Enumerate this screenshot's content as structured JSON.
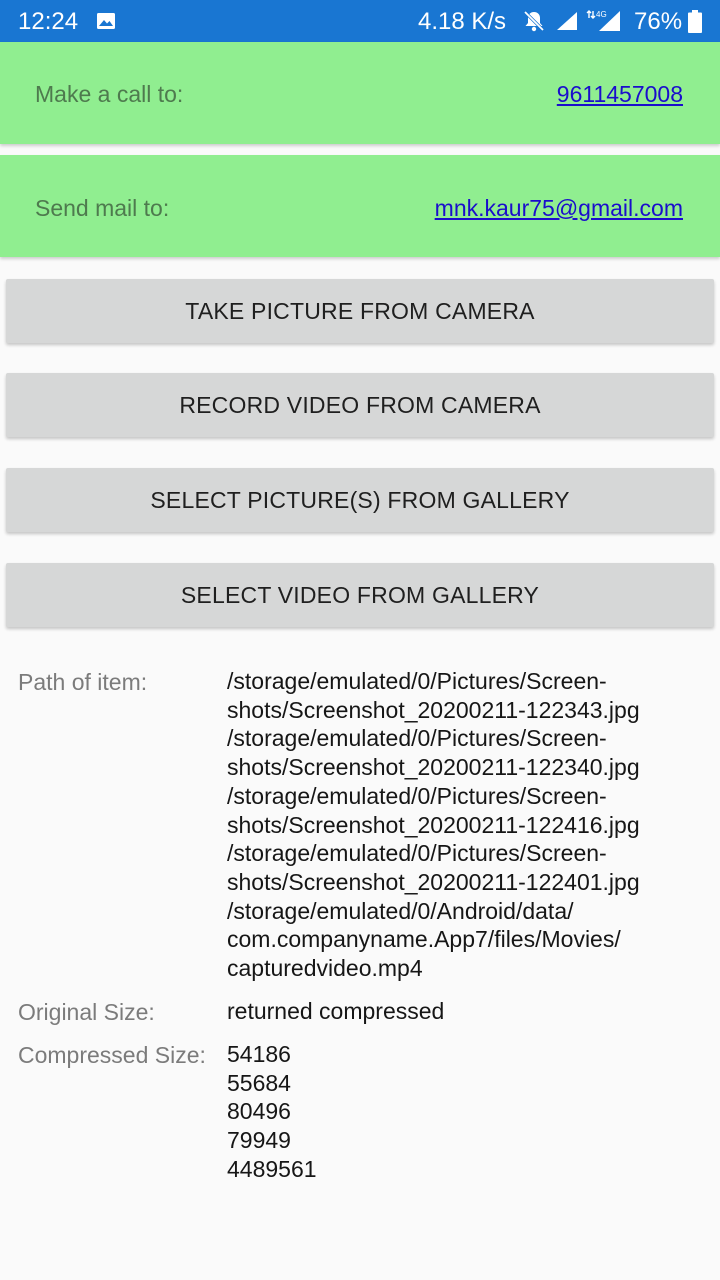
{
  "status_bar": {
    "time": "12:24",
    "network_speed": "4.18 K/s",
    "network_type": "4G",
    "battery": "76%",
    "icons": [
      "image-icon",
      "mute-icon",
      "signal-icon",
      "signal-4g-icon",
      "battery-icon"
    ]
  },
  "contact": {
    "call_label": "Make a call to:",
    "call_number": "9611457008",
    "mail_label": "Send mail to:",
    "mail_address": "mnk.kaur75@gmail.com"
  },
  "buttons": {
    "take_picture": "TAKE PICTURE FROM CAMERA",
    "record_video": "RECORD VIDEO FROM CAMERA",
    "select_pictures": "SELECT PICTURE(S) FROM GALLERY",
    "select_video": "SELECT VIDEO FROM GALLERY"
  },
  "info": {
    "path_label": "Path of item:",
    "path_lines": [
      "/storage/emulated/0/Pictures/Screen-",
      "shots/Screenshot_20200211-122343.jpg",
      "/storage/emulated/0/Pictures/Screen-",
      "shots/Screenshot_20200211-122340.jpg",
      "/storage/emulated/0/Pictures/Screen-",
      "shots/Screenshot_20200211-122416.jpg",
      "/storage/emulated/0/Pictures/Screen-",
      "shots/Screenshot_20200211-122401.jpg",
      "/storage/emulated/0/Android/data/",
      "com.companyname.App7/files/Movies/",
      "capturedvideo.mp4"
    ],
    "original_label": "Original Size:",
    "original_value": "returned compressed",
    "compressed_label": "Compressed Size:",
    "compressed_values": [
      "54186",
      "55684",
      "80496",
      "79949",
      "4489561"
    ]
  },
  "colors": {
    "status_bar": "#1976d2",
    "card_green": "#90ee90",
    "link": "#1a0dcc",
    "button_bg": "#d6d7d7"
  }
}
